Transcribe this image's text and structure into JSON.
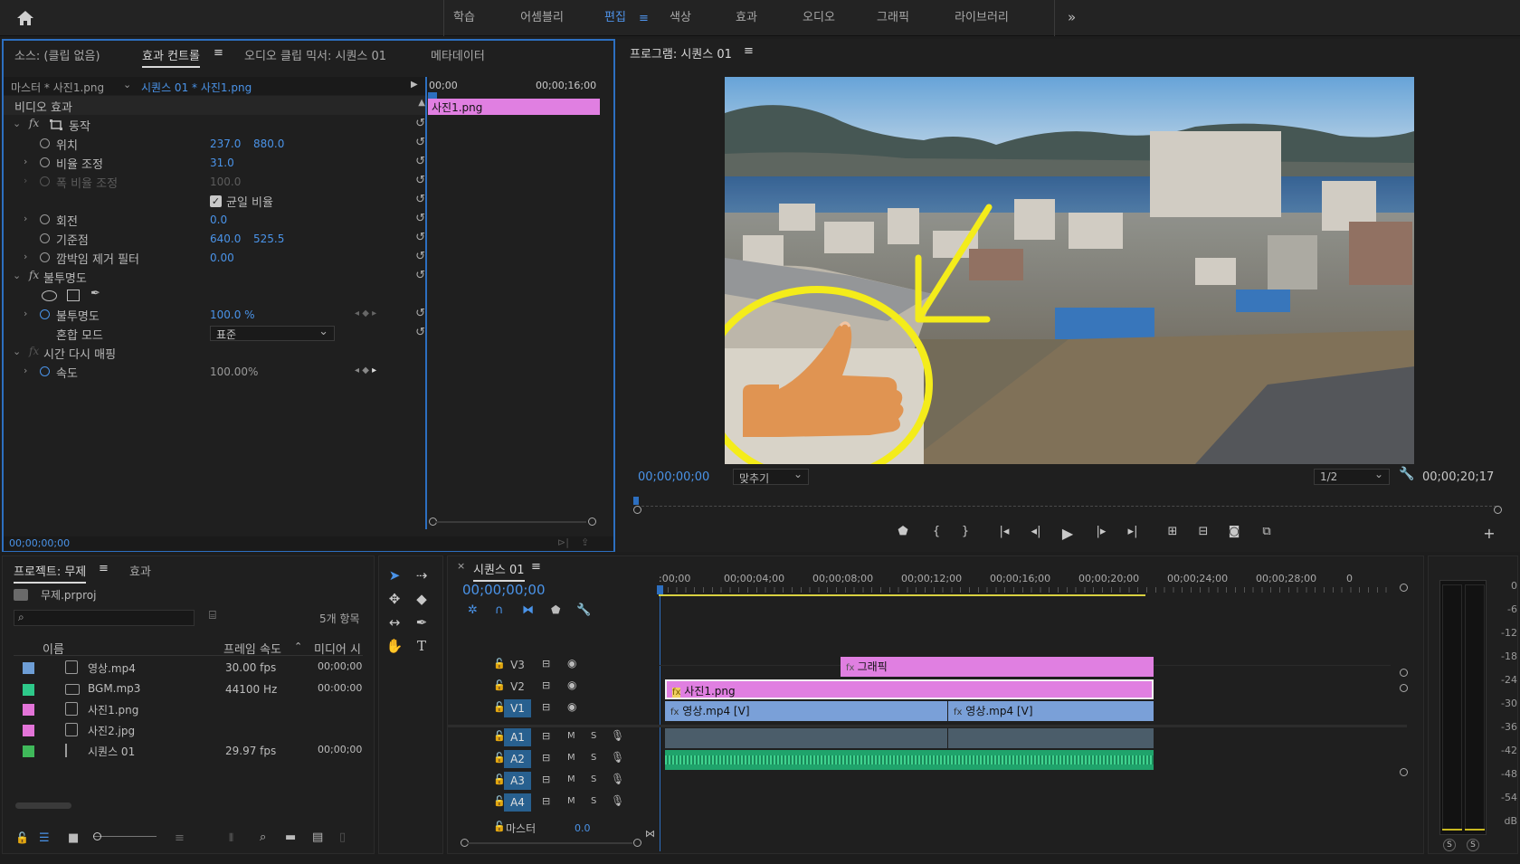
{
  "workspaces": [
    "학습",
    "어셈블리",
    "편집",
    "색상",
    "효과",
    "오디오",
    "그래픽",
    "라이브러리"
  ],
  "active_workspace_index": 2,
  "more_label": "»",
  "ec": {
    "tabs": [
      "소스: (클립 없음)",
      "효과 컨트롤",
      "오디오 클립 믹서: 시퀀스 01",
      "메타데이터"
    ],
    "master": "마스터 * 사진1.png",
    "sequence_clip": "시퀀스 01 * 사진1.png",
    "ruler_start": "00;00",
    "ruler_end": "00;00;16;00",
    "clip_name": "사진1.png",
    "video_effects": "비디오 효과",
    "motion": "동작",
    "position_label": "위치",
    "position_x": "237.0",
    "position_y": "880.0",
    "scale_label": "비율 조정",
    "scale": "31.0",
    "scale_width_label": "폭 비율 조정",
    "scale_width": "100.0",
    "uniform_label": "균일 비율",
    "rotation_label": "회전",
    "rotation": "0.0",
    "anchor_label": "기준점",
    "anchor_x": "640.0",
    "anchor_y": "525.5",
    "flicker_label": "깜박임 제거 필터",
    "flicker": "0.00",
    "opacity_group": "불투명도",
    "opacity_label": "불투명도",
    "opacity": "100.0 %",
    "blend_label": "혼합 모드",
    "blend": "표준",
    "time_remap": "시간 다시 매핑",
    "speed_label": "속도",
    "speed": "100.00%",
    "timecode": "00;00;00;00"
  },
  "program": {
    "title": "프로그램: 시퀀스 01",
    "timecode": "00;00;00;00",
    "fit": "맞추기",
    "quality": "1/2",
    "duration": "00;00;20;17"
  },
  "project": {
    "tabs": [
      "프로젝트: 무제",
      "효과"
    ],
    "file": "무제.prproj",
    "count": "5개 항목",
    "headers": [
      "이름",
      "프레임 속도",
      "미디어 시"
    ],
    "items": [
      {
        "name": "영상.mp4",
        "rate": "30.00 fps",
        "start": "00;00;00;0",
        "color": "#6e9ed6"
      },
      {
        "name": "BGM.mp3",
        "rate": "44100 Hz",
        "start": "00:00:00:0",
        "color": "#2ec98a"
      },
      {
        "name": "사진1.png",
        "rate": "",
        "start": "",
        "color": "#e374d8"
      },
      {
        "name": "사진2.jpg",
        "rate": "",
        "start": "",
        "color": "#e374d8"
      },
      {
        "name": "시퀀스 01",
        "rate": "29.97 fps",
        "start": "00;00;00;0",
        "color": "#3fb95a"
      }
    ]
  },
  "timeline": {
    "title": "시퀀스 01",
    "timecode": "00;00;00;00",
    "ruler": [
      ":00;00",
      "00;00;04;00",
      "00;00;08;00",
      "00;00;12;00",
      "00;00;16;00",
      "00;00;20;00",
      "00;00;24;00",
      "00;00;28;00",
      "0"
    ],
    "video_tracks": [
      "V3",
      "V2",
      "V1"
    ],
    "audio_tracks": [
      "A1",
      "A2",
      "A3",
      "A4"
    ],
    "master": "마스터",
    "master_value": "0.0",
    "clip_graphic": "그래픽",
    "clip_photo": "사진1.png",
    "clip_video1": "영상.mp4 [V]",
    "clip_video2": "영상.mp4 [V]",
    "m_label": "M",
    "s_label": "S"
  },
  "meter": {
    "labels": [
      "0",
      "-6",
      "-12",
      "-18",
      "-24",
      "-30",
      "-36",
      "-42",
      "-48",
      "-54",
      "dB"
    ],
    "solo": "S"
  },
  "colors": {
    "accent": "#2d6fc0",
    "graphic_clip": "#e07fe1",
    "video_clip": "#7aa0d8",
    "audio_clip": "#1fa36b",
    "annotation": "#f4ec1a"
  }
}
